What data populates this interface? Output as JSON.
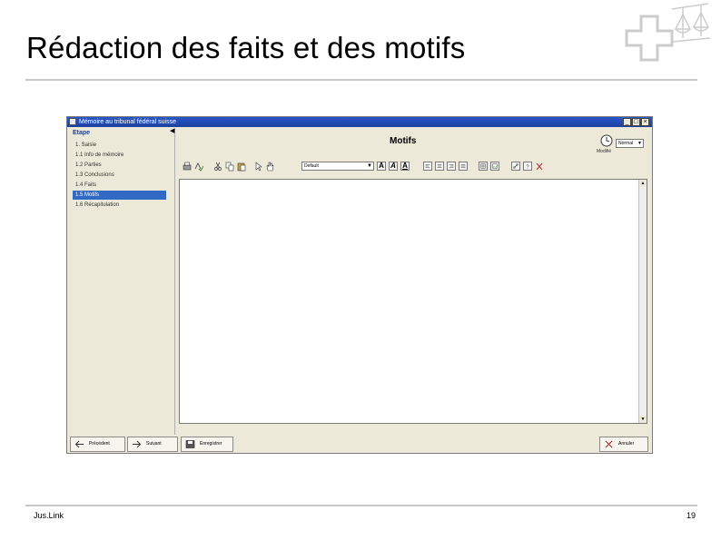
{
  "slide": {
    "title": "Rédaction des faits et des motifs",
    "footer_left": "Jus.Link",
    "page_number": "19"
  },
  "window": {
    "title": "Mémoire au tribunal fédéral suisse",
    "controls": {
      "minimize": "_",
      "maximize": "□",
      "close": "×"
    },
    "colors": {
      "titlebar": "#1b3fa0",
      "selection": "#316ac5",
      "chrome": "#ece9d8"
    }
  },
  "sidebar": {
    "header": "Etape",
    "items": [
      {
        "label": "1. Saisie"
      },
      {
        "label": "  1.1 Info de mémoire"
      },
      {
        "label": "1.2 Parties"
      },
      {
        "label": "1.3 Conclusions"
      },
      {
        "label": "1.4 Faits"
      },
      {
        "label": "1.5 Motifs"
      },
      {
        "label": "1.6 Récapitulation"
      }
    ],
    "selected_index": 5
  },
  "main": {
    "heading": "Motifs",
    "clock_caption": "Modifié",
    "style_select": "Normal",
    "font_select": "Default",
    "toolbar_bold": "A",
    "toolbar_italic": "A",
    "toolbar_underline": "A",
    "toolbar_icons": [
      "print-icon",
      "spellcheck-icon",
      "cut-icon",
      "copy-icon",
      "paste-icon",
      "pointer-icon",
      "hand-icon",
      "align-left-icon",
      "align-center-icon",
      "align-right-icon",
      "justify-icon",
      "table-icon",
      "image-icon",
      "link-icon",
      "help-icon",
      "clear-format-icon"
    ]
  },
  "bottom_bar": {
    "previous": "Précédent",
    "next": "Suivant",
    "save": "Enregistrer",
    "cancel": "Annuler"
  }
}
